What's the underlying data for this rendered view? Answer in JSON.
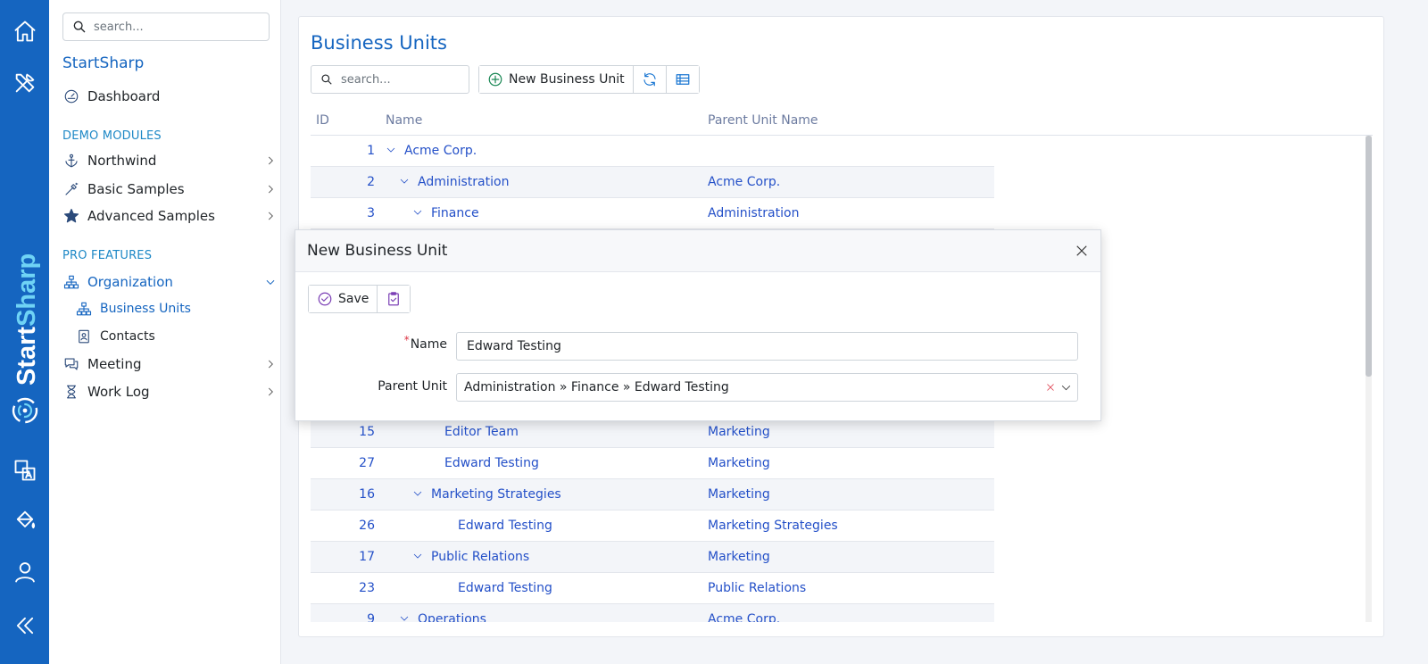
{
  "rail": {
    "brand_part1": "Start",
    "brand_part2": "Sharp",
    "icons": [
      "home-icon",
      "tools-icon",
      "translate-icon",
      "paint-bucket-icon",
      "user-icon",
      "collapse-icon"
    ]
  },
  "sidebar": {
    "search_placeholder": "search...",
    "app_title": "StartSharp",
    "dashboard": "Dashboard",
    "demo_header": "DEMO MODULES",
    "northwind": "Northwind",
    "basic_samples": "Basic Samples",
    "advanced_samples": "Advanced Samples",
    "pro_header": "PRO FEATURES",
    "organization": "Organization",
    "business_units": "Business Units",
    "contacts": "Contacts",
    "meeting": "Meeting",
    "work_log": "Work Log"
  },
  "main": {
    "title": "Business Units",
    "search_placeholder": "search...",
    "new_button": "New Business Unit",
    "columns": {
      "id": "ID",
      "name": "Name",
      "parent": "Parent Unit Name"
    },
    "rows": [
      {
        "id": "1",
        "name": "Acme Corp.",
        "parent": "",
        "level": 0,
        "expand": true
      },
      {
        "id": "2",
        "name": "Administration",
        "parent": "Acme Corp.",
        "level": 1,
        "expand": true
      },
      {
        "id": "3",
        "name": "Finance",
        "parent": "Administration",
        "level": 2,
        "expand": true
      },
      {
        "id": "",
        "name": "",
        "parent": "",
        "level": 0,
        "expand": false
      },
      {
        "id": "",
        "name": "",
        "parent": "",
        "level": 0,
        "expand": false
      },
      {
        "id": "",
        "name": "",
        "parent": "",
        "level": 0,
        "expand": false
      },
      {
        "id": "",
        "name": "",
        "parent": "",
        "level": 0,
        "expand": false
      },
      {
        "id": "",
        "name": "",
        "parent": "",
        "level": 0,
        "expand": false
      },
      {
        "id": "",
        "name": "",
        "parent": "",
        "level": 0,
        "expand": false
      },
      {
        "id": "15",
        "name": "Editor Team",
        "parent": "Marketing",
        "level": 3,
        "expand": false
      },
      {
        "id": "27",
        "name": "Edward Testing",
        "parent": "Marketing",
        "level": 3,
        "expand": false
      },
      {
        "id": "16",
        "name": "Marketing Strategies",
        "parent": "Marketing",
        "level": 2,
        "expand": true
      },
      {
        "id": "26",
        "name": "Edward Testing",
        "parent": "Marketing Strategies",
        "level": 4,
        "expand": false
      },
      {
        "id": "17",
        "name": "Public Relations",
        "parent": "Marketing",
        "level": 2,
        "expand": true
      },
      {
        "id": "23",
        "name": "Edward Testing",
        "parent": "Public Relations",
        "level": 4,
        "expand": false
      },
      {
        "id": "9",
        "name": "Operations",
        "parent": "Acme Corp.",
        "level": 1,
        "expand": true
      }
    ]
  },
  "dialog": {
    "title": "New Business Unit",
    "save": "Save",
    "name_label": "Name",
    "name_value": "Edward Testing",
    "parent_label": "Parent Unit",
    "parent_value": "Administration » Finance » Edward Testing"
  }
}
